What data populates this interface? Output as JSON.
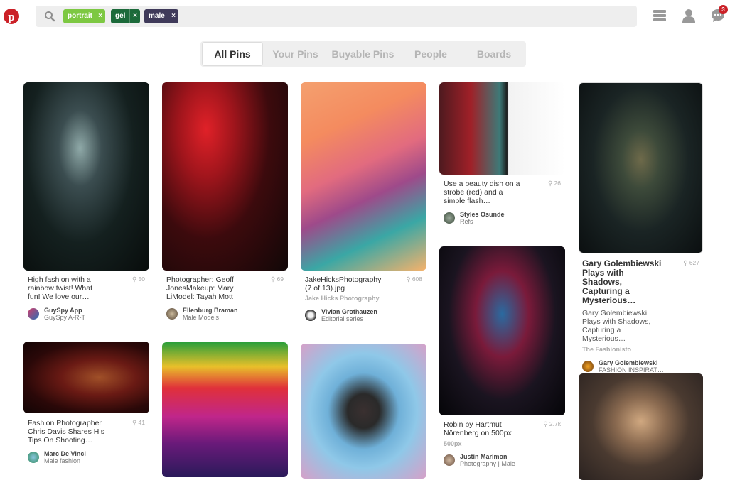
{
  "header": {
    "brand_color": "#cb2027",
    "chips": [
      {
        "label": "portrait",
        "color": "#7dc842",
        "remove": "×"
      },
      {
        "label": "gel",
        "color": "#1c6a3a",
        "remove": "×"
      },
      {
        "label": "male",
        "color": "#3f3a5a",
        "remove": "×"
      }
    ],
    "icons": [
      "menu-icon",
      "profile-icon",
      "messages-icon"
    ],
    "notification_count": "3"
  },
  "tabs": [
    {
      "label": "All Pins",
      "active": true
    },
    {
      "label": "Your Pins"
    },
    {
      "label": "Buyable Pins"
    },
    {
      "label": "People"
    },
    {
      "label": "Boards"
    }
  ],
  "pins": [
    {
      "description": "High fashion with a rainbow twist! What fun! We love our…",
      "count": "50",
      "pinner": "GuySpy App",
      "board": "GuySpy A-R-T"
    },
    {
      "description": "Photographer: Geoff JonesMakeup: Mary LiModel: Tayah Mott",
      "count": "69",
      "pinner": "Ellenburg Braman",
      "board": "Male Models"
    },
    {
      "description": "JakeHicksPhotography (7 of 13).jpg",
      "source": "Jake Hicks Photography",
      "count": "608",
      "pinner": "Vivian Grothauzen",
      "board": "Editorial series"
    },
    {
      "description": "Use a beauty dish on a strobe (red) and a simple flash…",
      "count": "26",
      "pinner": "Styles Osunde",
      "board": "Refs"
    },
    {
      "title": "Gary Golembiewski Plays with Shadows, Capturing a Mysterious…",
      "description": "Gary Golembiewski Plays with Shadows, Capturing a Mysterious…",
      "source": "The Fashionisto",
      "count": "627",
      "pinner": "Gary Golembiewski",
      "board": "FASHION INSPIRAT…"
    },
    {
      "description": "Fashion Photographer Chris Davis Shares His Tips On Shooting…",
      "count": "41",
      "pinner": "Marc De Vinci",
      "board": "Male fashion"
    },
    {
      "description": "Robin by Hartmut Nörenberg on 500px",
      "source": "500px",
      "count": "2.7k",
      "pinner": "Justin Marimon",
      "board": "Photography | Male"
    }
  ]
}
